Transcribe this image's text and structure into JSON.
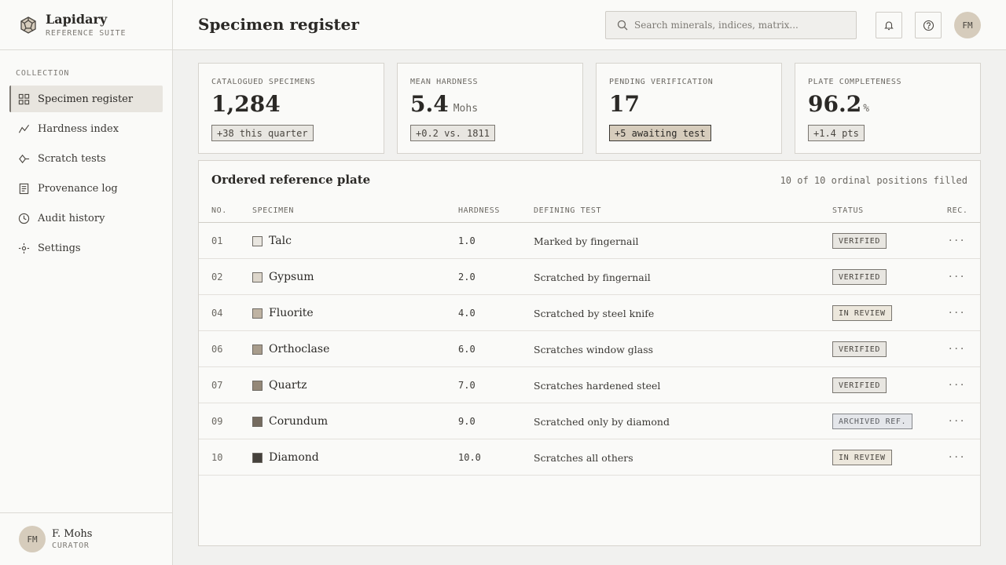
{
  "brand": {
    "name": "Lapidary",
    "subtitle": "REFERENCE SUITE"
  },
  "sidebar": {
    "heading": "COLLECTION",
    "items": [
      {
        "label": "Specimen register",
        "icon": "grid-icon",
        "active": true
      },
      {
        "label": "Hardness index",
        "icon": "trend-line-icon"
      },
      {
        "label": "Scratch tests",
        "icon": "diamond-line-icon"
      },
      {
        "label": "Provenance log",
        "icon": "document-icon"
      },
      {
        "label": "Audit history",
        "icon": "clock-icon"
      },
      {
        "label": "Settings",
        "icon": "settings-icon"
      }
    ]
  },
  "profile": {
    "initials": "FM",
    "name": "F. Mohs",
    "role": "CURATOR"
  },
  "header": {
    "title": "Specimen register",
    "search_placeholder": "Search minerals, indices, matrix...",
    "avatar_initials": "FM"
  },
  "kpis": [
    {
      "label": "CATALOGUED SPECIMENS",
      "value": "1,284",
      "unit": "",
      "badge": "+38 this quarter"
    },
    {
      "label": "MEAN HARDNESS",
      "value": "5.4",
      "unit": "Mohs",
      "badge": "+0.2 vs. 1811"
    },
    {
      "label": "PENDING VERIFICATION",
      "value": "17",
      "unit": "",
      "badge": "+5 awaiting test"
    },
    {
      "label": "PLATE COMPLETENESS",
      "value": "96.2",
      "unit": "%",
      "badge": "+1.4 pts"
    }
  ],
  "table": {
    "title": "Ordered reference plate",
    "meta": "10 of 10 ordinal positions filled",
    "columns": [
      "NO.",
      "SPECIMEN",
      "HARDNESS",
      "DEFINING TEST",
      "STATUS",
      "REC."
    ],
    "rows": [
      {
        "no": "01",
        "specimen": "Talc",
        "hardness": "1.0",
        "test": "Marked by fingernail",
        "status": "VERIFIED",
        "swatch": "#e9e6e0"
      },
      {
        "no": "02",
        "specimen": "Gypsum",
        "hardness": "2.0",
        "test": "Scratched by fingernail",
        "status": "VERIFIED",
        "swatch": "#ddd6cb"
      },
      {
        "no": "04",
        "specimen": "Fluorite",
        "hardness": "4.0",
        "test": "Scratched by steel knife",
        "status": "IN REVIEW",
        "swatch": "#bfb3a3"
      },
      {
        "no": "06",
        "specimen": "Orthoclase",
        "hardness": "6.0",
        "test": "Scratches window glass",
        "status": "VERIFIED",
        "swatch": "#a89c8c"
      },
      {
        "no": "07",
        "specimen": "Quartz",
        "hardness": "7.0",
        "test": "Scratches hardened steel",
        "status": "VERIFIED",
        "swatch": "#948878"
      },
      {
        "no": "09",
        "specimen": "Corundum",
        "hardness": "9.0",
        "test": "Scratched only by diamond",
        "status": "ARCHIVED REF.",
        "swatch": "#756b5f"
      },
      {
        "no": "10",
        "specimen": "Diamond",
        "hardness": "10.0",
        "test": "Scratches all others",
        "status": "IN REVIEW",
        "swatch": "#45413c"
      }
    ],
    "more_label": "···"
  }
}
